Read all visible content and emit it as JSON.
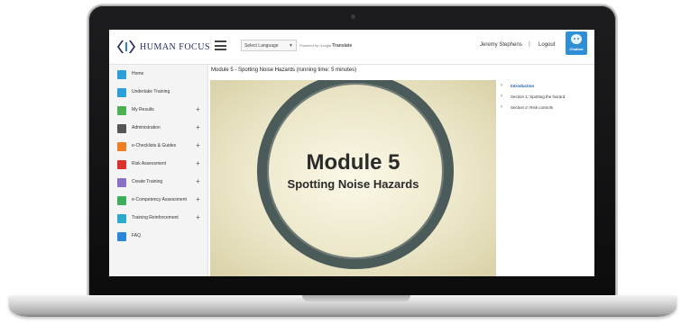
{
  "brand": {
    "name": "HUMAN FOCUS",
    "accent": "#1f2a5a"
  },
  "header": {
    "language_select": "Select Language",
    "powered_by": "Powered by",
    "google": "Google",
    "translate": "Translate",
    "user_name": "Jeremy Stephens",
    "separator": "|",
    "logout": "Logout",
    "chatbot": "Chatbot"
  },
  "sidebar": {
    "items": [
      {
        "label": "Home",
        "icon": "home-icon",
        "color": "#2a9fd8",
        "plus": ""
      },
      {
        "label": "Undertake Training",
        "icon": "person-icon",
        "color": "#2a9fd8",
        "plus": ""
      },
      {
        "label": "My Results",
        "icon": "results-icon",
        "color": "#4caf50",
        "plus": "+"
      },
      {
        "label": "Administration",
        "icon": "admin-icon",
        "color": "#555555",
        "plus": "+"
      },
      {
        "label": "e-Checklists & Guides",
        "icon": "checklist-icon",
        "color": "#ef7d22",
        "plus": "+"
      },
      {
        "label": "Risk Assessment",
        "icon": "warning-icon",
        "color": "#d9342b",
        "plus": "+"
      },
      {
        "label": "Create Training",
        "icon": "pencil-icon",
        "color": "#8a6fc8",
        "plus": "+"
      },
      {
        "label": "e-Competency Assessment",
        "icon": "competency-icon",
        "color": "#3fae5a",
        "plus": "+"
      },
      {
        "label": "Training Reinforcement",
        "icon": "reinforcement-icon",
        "color": "#2aa9c9",
        "plus": "+"
      },
      {
        "label": "FAQ",
        "icon": "faq-icon",
        "color": "#2a86d8",
        "plus": ""
      }
    ]
  },
  "main": {
    "title": "Module 5 - Spotting Noise Hazards (running time: 5 minutes)",
    "video_title": "Module 5",
    "video_subtitle": "Spotting Noise Hazards"
  },
  "toc": {
    "items": [
      {
        "label": "Introduction",
        "active": true
      },
      {
        "label": "Section 1: Spotting the hazard",
        "active": false
      },
      {
        "label": "Section 2: Risk controls",
        "active": false
      }
    ]
  }
}
